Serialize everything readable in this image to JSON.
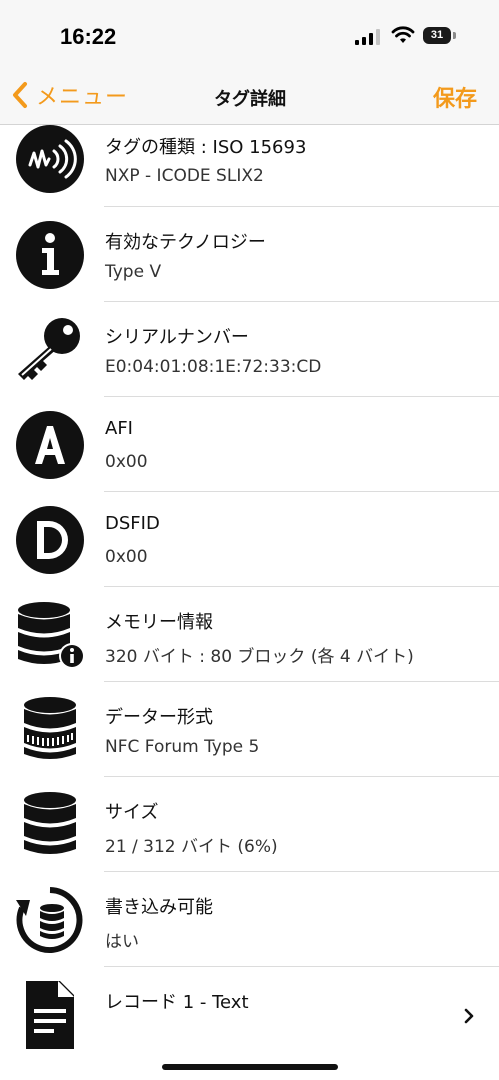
{
  "status": {
    "time": "16:22",
    "battery": "31"
  },
  "nav": {
    "back_label": "メニュー",
    "title": "タグ詳細",
    "save_label": "保存"
  },
  "rows": [
    {
      "icon": "nfc-tag-icon",
      "label": "タグの種類 : ISO 15693",
      "value": "NXP - ICODE SLIX2"
    },
    {
      "icon": "info-icon",
      "label": "有効なテクノロジー",
      "value": "Type V"
    },
    {
      "icon": "key-icon",
      "label": "シリアルナンバー",
      "value": "E0:04:01:08:1E:72:33:CD"
    },
    {
      "icon": "letter-a-icon",
      "label": "AFI",
      "value": "0x00"
    },
    {
      "icon": "letter-d-icon",
      "label": "DSFID",
      "value": "0x00"
    },
    {
      "icon": "database-info-icon",
      "label": "メモリー情報",
      "value": "320 バイト : 80 ブロック (各 4 バイト)"
    },
    {
      "icon": "database-format-icon",
      "label": "データー形式",
      "value": "NFC Forum Type 5"
    },
    {
      "icon": "database-icon",
      "label": "サイズ",
      "value": "21 / 312 バイト (6%)"
    },
    {
      "icon": "database-refresh-icon",
      "label": "書き込み可能",
      "value": "はい"
    },
    {
      "icon": "document-icon",
      "label": "レコード 1 - Text",
      "value": ""
    }
  ],
  "colors": {
    "accent": "#f39a1c",
    "icon": "#111111",
    "separator": "#dcdcdc"
  }
}
